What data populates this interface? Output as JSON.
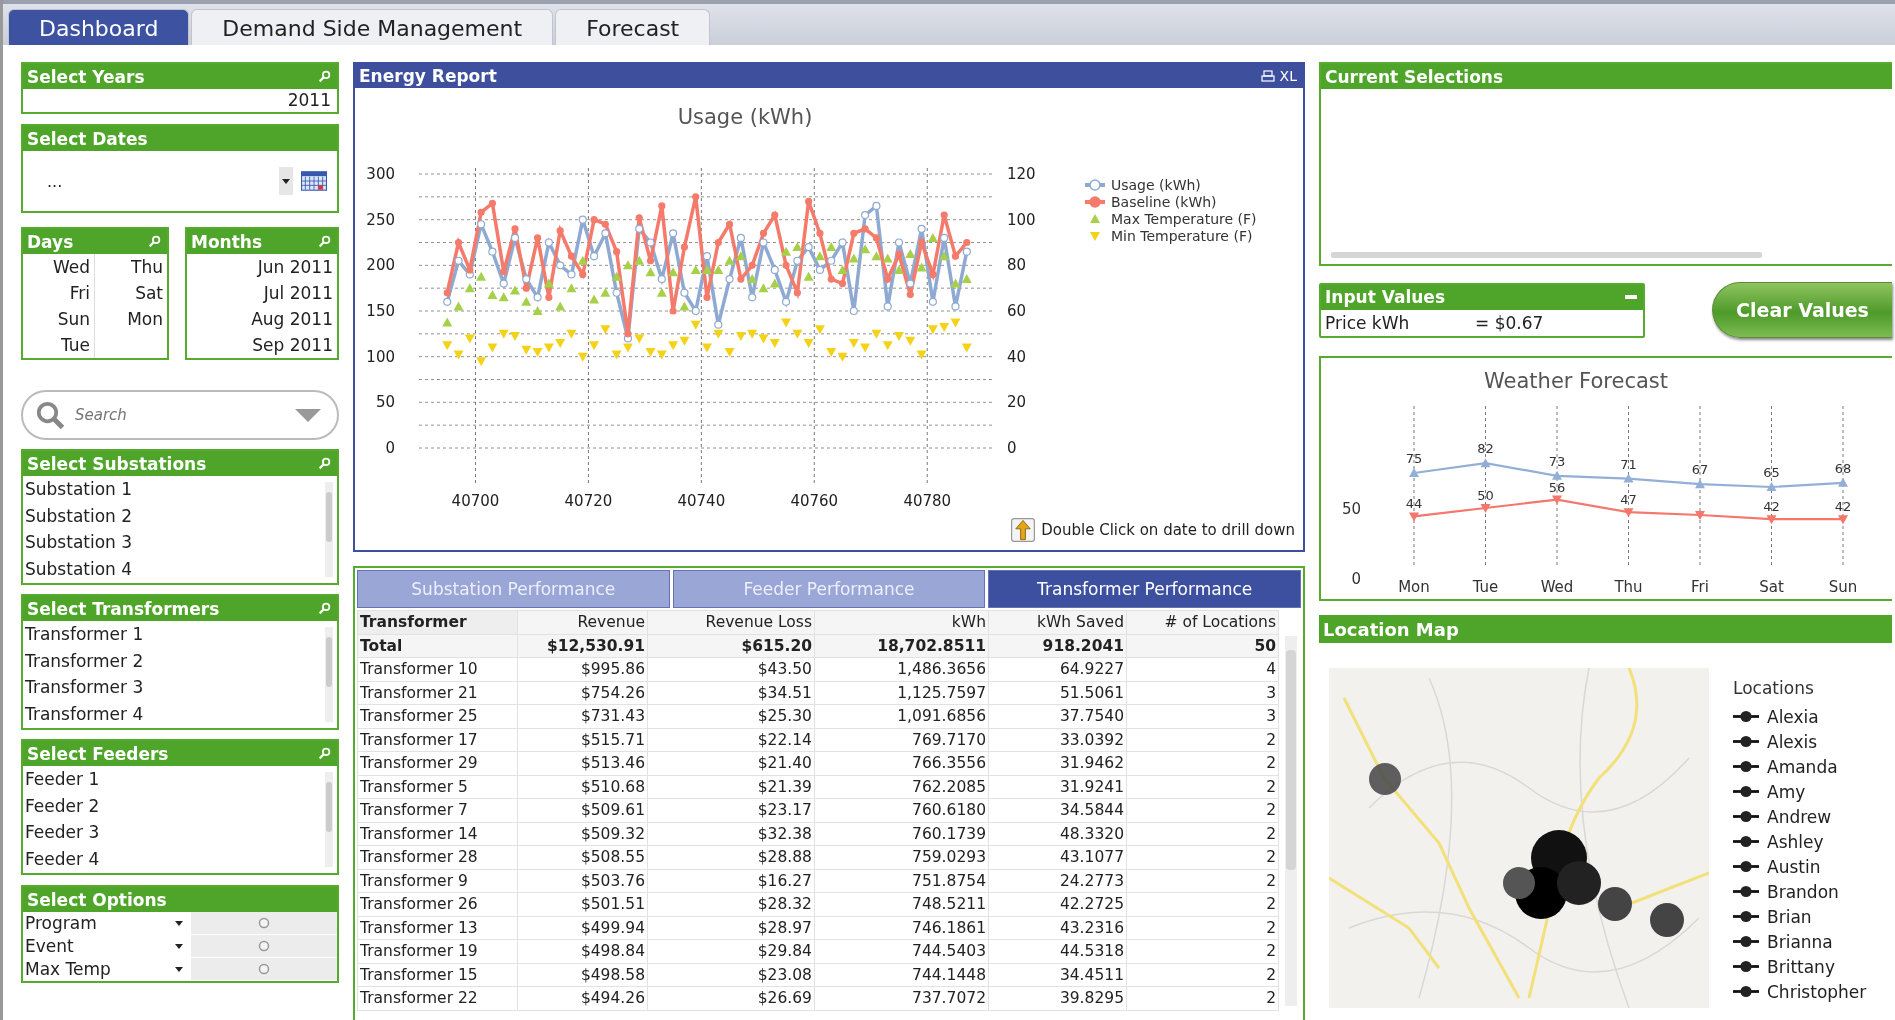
{
  "tabs": [
    {
      "label": "Dashboard",
      "selected": true
    },
    {
      "label": "Demand Side Management",
      "selected": false
    },
    {
      "label": "Forecast",
      "selected": false
    }
  ],
  "select_years": {
    "title": "Select Years",
    "value": "2011"
  },
  "select_dates": {
    "title": "Select Dates",
    "value": "..."
  },
  "days": {
    "title": "Days",
    "items": [
      "Wed",
      "Thu",
      "Fri",
      "Sat",
      "Sun",
      "Mon",
      "Tue"
    ]
  },
  "months": {
    "title": "Months",
    "items": [
      "Jun 2011",
      "Jul 2011",
      "Aug 2011",
      "Sep 2011"
    ]
  },
  "search": {
    "placeholder": "Search"
  },
  "listboxes": [
    {
      "title": "Select Substations",
      "items": [
        "Substation 1",
        "Substation 2",
        "Substation 3",
        "Substation 4"
      ]
    },
    {
      "title": "Select Transformers",
      "items": [
        "Transformer 1",
        "Transformer 2",
        "Transformer 3",
        "Transformer 4"
      ]
    },
    {
      "title": "Select Feeders",
      "items": [
        "Feeder 1",
        "Feeder 2",
        "Feeder 3",
        "Feeder 4"
      ]
    }
  ],
  "select_options": {
    "title": "Select Options",
    "rows": [
      "Program",
      "Event",
      "Max Temp"
    ]
  },
  "energy_report": {
    "title": "Energy Report",
    "export_label": "XL",
    "note": "Double Click on date to drill down",
    "chart_data": {
      "type": "line",
      "title": "Usage (kWh)",
      "x": [
        40695,
        40697,
        40699,
        40701,
        40703,
        40705,
        40707,
        40709,
        40711,
        40713,
        40715,
        40717,
        40719,
        40721,
        40723,
        40725,
        40727,
        40729,
        40731,
        40733,
        40735,
        40737,
        40739,
        40741,
        40743,
        40745,
        40747,
        40749,
        40751,
        40753,
        40755,
        40757,
        40759,
        40761,
        40763,
        40765,
        40767,
        40769,
        40771,
        40773,
        40775,
        40777,
        40779,
        40781,
        40783,
        40785,
        40787
      ],
      "legend": "right",
      "xlim": [
        40690,
        40792
      ],
      "xticks": [
        40700,
        40720,
        40740,
        40760,
        40780
      ],
      "yticks": [
        0,
        50,
        100,
        150,
        200,
        250,
        300
      ],
      "ylim": [
        0,
        300
      ],
      "y2lim": [
        0,
        120
      ],
      "y2ticks": [
        0,
        20,
        40,
        60,
        80,
        100,
        120
      ],
      "grid": true,
      "series": [
        {
          "name": "Usage (kWh)",
          "color": "#8eaad2",
          "marker": "circle",
          "values": [
            160,
            205,
            190,
            245,
            215,
            180,
            230,
            185,
            165,
            225,
            200,
            190,
            250,
            210,
            235,
            170,
            120,
            240,
            225,
            185,
            235,
            170,
            150,
            210,
            135,
            185,
            230,
            165,
            225,
            195,
            160,
            205,
            220,
            195,
            205,
            225,
            150,
            255,
            265,
            155,
            225,
            180,
            240,
            160,
            230,
            155,
            215
          ]
        },
        {
          "name": "Baseline (kWh)",
          "color": "#f47b6b",
          "marker": "circle",
          "values": [
            170,
            225,
            195,
            258,
            268,
            193,
            240,
            175,
            230,
            165,
            238,
            210,
            190,
            250,
            245,
            215,
            125,
            252,
            205,
            265,
            150,
            220,
            275,
            165,
            225,
            245,
            185,
            200,
            235,
            255,
            200,
            170,
            270,
            235,
            185,
            180,
            235,
            240,
            230,
            185,
            212,
            168,
            225,
            190,
            255,
            210,
            225
          ]
        },
        {
          "name": "Max Temperature (F)",
          "color": "#a6d04a",
          "type": "scatter",
          "marker": "triangle",
          "axis": "y2",
          "values": [
            55,
            62,
            70,
            75,
            67,
            66,
            69,
            64,
            60,
            72,
            62,
            70,
            82,
            65,
            68,
            75,
            80,
            82,
            77,
            68,
            77,
            62,
            78,
            78,
            78,
            82,
            84,
            74,
            70,
            72,
            86,
            88,
            75,
            84,
            88,
            78,
            83,
            87,
            84,
            83,
            78,
            85,
            79,
            92,
            84,
            72,
            74
          ]
        },
        {
          "name": "Min Temperature (F)",
          "color": "#f5d21a",
          "type": "scatter",
          "marker": "triangle",
          "axis": "y2",
          "values": [
            45,
            41,
            48,
            38,
            44,
            50,
            49,
            43,
            42,
            44,
            46,
            50,
            40,
            45,
            52,
            41,
            44,
            48,
            42,
            41,
            45,
            47,
            54,
            44,
            50,
            42,
            49,
            50,
            48,
            46,
            55,
            50,
            46,
            52,
            42,
            40,
            46,
            44,
            50,
            45,
            49,
            47,
            41,
            52,
            53,
            55,
            44
          ]
        }
      ]
    }
  },
  "performance_tabs": [
    {
      "label": "Substation Performance",
      "selected": false
    },
    {
      "label": "Feeder Performance",
      "selected": false
    },
    {
      "label": "Transformer Performance",
      "selected": true
    }
  ],
  "table": {
    "columns": [
      "Transformer",
      "Revenue",
      "Revenue Loss",
      "kWh",
      "kWh Saved",
      "# of Locations"
    ],
    "total": [
      "Total",
      "$12,530.91",
      "$615.20",
      "18,702.8511",
      "918.2041",
      "50"
    ],
    "rows": [
      [
        "Transformer 10",
        "$995.86",
        "$43.50",
        "1,486.3656",
        "64.9227",
        "4"
      ],
      [
        "Transformer 21",
        "$754.26",
        "$34.51",
        "1,125.7597",
        "51.5061",
        "3"
      ],
      [
        "Transformer 25",
        "$731.43",
        "$25.30",
        "1,091.6856",
        "37.7540",
        "3"
      ],
      [
        "Transformer 17",
        "$515.71",
        "$22.14",
        "769.7170",
        "33.0392",
        "2"
      ],
      [
        "Transformer 29",
        "$513.46",
        "$21.40",
        "766.3556",
        "31.9462",
        "2"
      ],
      [
        "Transformer 5",
        "$510.68",
        "$21.39",
        "762.2085",
        "31.9241",
        "2"
      ],
      [
        "Transformer 7",
        "$509.61",
        "$23.17",
        "760.6180",
        "34.5844",
        "2"
      ],
      [
        "Transformer 14",
        "$509.32",
        "$32.38",
        "760.1739",
        "48.3320",
        "2"
      ],
      [
        "Transformer 28",
        "$508.55",
        "$28.88",
        "759.0293",
        "43.1077",
        "2"
      ],
      [
        "Transformer 9",
        "$503.76",
        "$16.27",
        "751.8754",
        "24.2773",
        "2"
      ],
      [
        "Transformer 26",
        "$501.51",
        "$28.32",
        "748.5211",
        "42.2725",
        "2"
      ],
      [
        "Transformer 13",
        "$499.94",
        "$28.97",
        "746.1861",
        "43.2316",
        "2"
      ],
      [
        "Transformer 19",
        "$498.84",
        "$29.84",
        "744.5403",
        "44.5318",
        "2"
      ],
      [
        "Transformer 15",
        "$498.58",
        "$23.08",
        "744.1448",
        "34.4511",
        "2"
      ],
      [
        "Transformer 22",
        "$494.26",
        "$26.69",
        "737.7072",
        "39.8295",
        "2"
      ]
    ]
  },
  "current_selections": {
    "title": "Current Selections"
  },
  "input_values": {
    "title": "Input Values",
    "label": "Price kWh",
    "value": "= $0.67"
  },
  "clear_button": "Clear Values",
  "weather": {
    "chart_data": {
      "type": "line",
      "title": "Weather Forecast",
      "categories": [
        "Mon",
        "Tue",
        "Wed",
        "Thu",
        "Fri",
        "Sat",
        "Sun"
      ],
      "yticks": [
        0,
        50
      ],
      "ylim": [
        0,
        120
      ],
      "grid": true,
      "series": [
        {
          "color": "#94afd6",
          "marker": "triangle",
          "values": [
            75,
            82,
            73,
            71,
            67,
            65,
            68
          ],
          "value_labels": [
            "75",
            "82",
            "73",
            "71",
            "67",
            "65",
            "68"
          ]
        },
        {
          "color": "#f5766a",
          "marker": "triangle",
          "values": [
            44,
            50,
            56,
            47,
            45,
            42,
            42
          ],
          "value_labels": [
            "44",
            "50",
            "56",
            "47",
            null,
            "42",
            "42"
          ]
        }
      ]
    }
  },
  "location_map": {
    "title": "Location Map",
    "legend_title": "Locations",
    "locations": [
      "Alexia",
      "Alexis",
      "Amanda",
      "Amy",
      "Andrew",
      "Ashley",
      "Austin",
      "Brandon",
      "Brian",
      "Brianna",
      "Brittany",
      "Christopher"
    ]
  }
}
